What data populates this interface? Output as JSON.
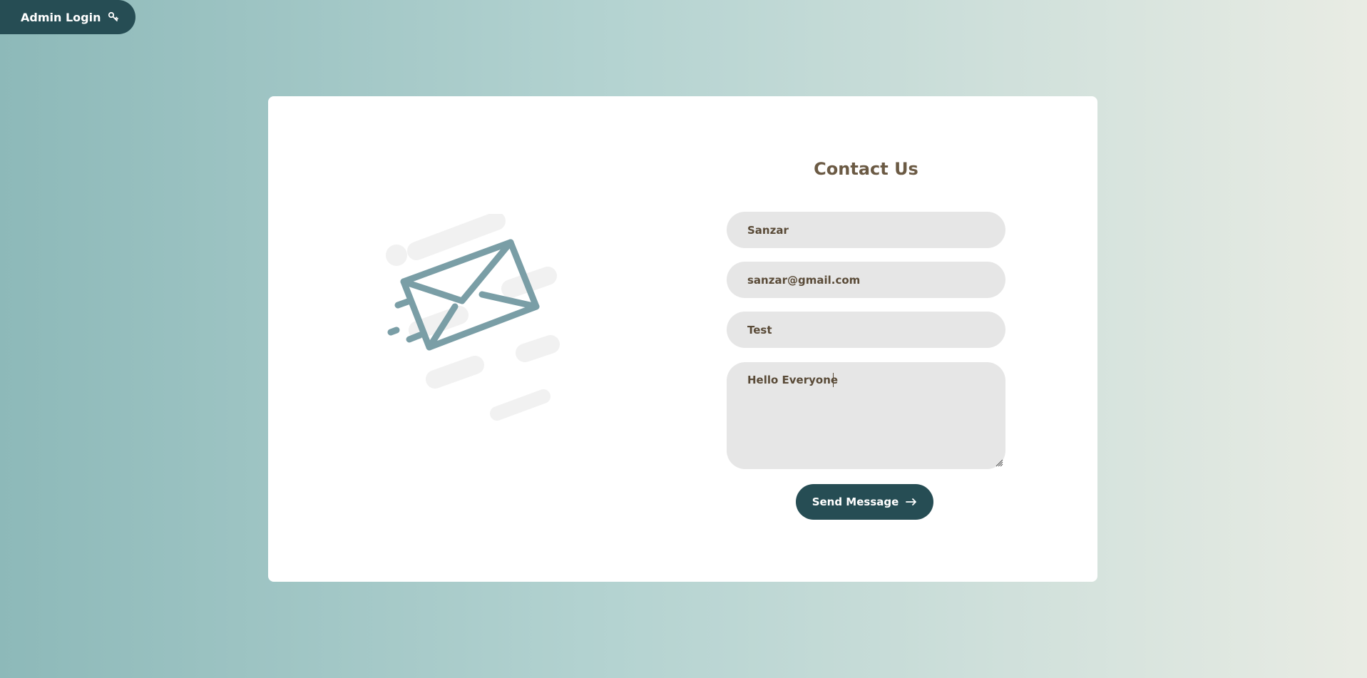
{
  "header": {
    "admin_login_label": "Admin Login",
    "admin_icon": "key-icon"
  },
  "contact": {
    "title": "Contact Us",
    "name_value": "Sanzar",
    "email_value": "sanzar@gmail.com",
    "subject_value": "Test",
    "message_value": "Hello Everyone",
    "send_label": "Send Message",
    "send_icon": "arrow-right-icon",
    "illustration_icon": "envelope-icon"
  },
  "colors": {
    "primary": "#264d54",
    "title": "#6b5a44",
    "field_bg": "#e6e6e6",
    "envelope": "#7a9ea6"
  }
}
